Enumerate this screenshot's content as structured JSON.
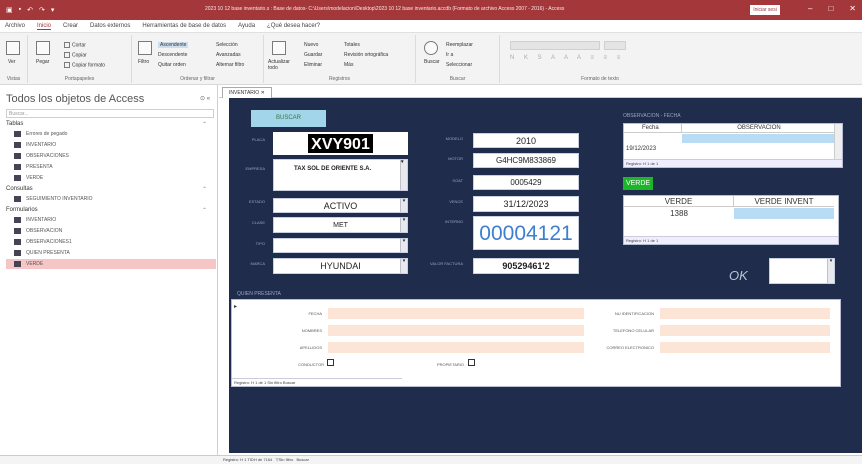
{
  "titlebar": {
    "title": "2023 10 12 base inventario.s : Base de datos- C:\\Users\\modelacion\\Desktop\\2023 10 12 base inventario.accdb (Formato de archivo Access 2007 - 2016) - Access",
    "user": "Iniciar sesi"
  },
  "menu": [
    "Archivo",
    "Inicio",
    "Crear",
    "Datos externos",
    "Herramientas de base de datos",
    "Ayuda",
    "¿Qué desea hacer?"
  ],
  "ribbon": {
    "groups": [
      "Vistas",
      "Portapapeles",
      "Ordenar y filtrar",
      "Registros",
      "Buscar",
      "Formato de texto"
    ],
    "view": "Ver",
    "paste": "Pegar",
    "cut": "Cortar",
    "copy": "Copiar",
    "painter": "Copiar formato",
    "filter": "Filtro",
    "asc": "Ascendente",
    "desc": "Descendente",
    "remove_sort": "Quitar orden",
    "selection": "Selección",
    "advanced": "Avanzadas",
    "toggle": "Alternar filtro",
    "refresh": "Actualizar todo",
    "new": "Nuevo",
    "save": "Guardar",
    "delete": "Eliminar",
    "totals": "Totales",
    "spelling": "Revisión ortográfica",
    "more": "Más",
    "find": "Buscar",
    "replace": "Reemplazar",
    "goto": "Ir a",
    "select": "Seleccionar"
  },
  "nav": {
    "header": "Todos los objetos de Access",
    "search": "Buscar...",
    "tables_title": "Tablas",
    "tables": [
      "Errores de pegado",
      "INVENTARIO",
      "OBSERVACIONES",
      "PRESENTA",
      "VERDE"
    ],
    "queries_title": "Consultas",
    "queries": [
      "SEGUIMIENTO INVENTARIO"
    ],
    "forms_title": "Formularios",
    "forms": [
      "INVENTARIO",
      "OBSERVACION",
      "OBSERVACIONES1",
      "QUIEN PRESENTA",
      "VERDE"
    ]
  },
  "doctab": "INVENTARIO",
  "form": {
    "buscar": "BUSCAR",
    "labels": {
      "placa": "PLACA",
      "empresa": "EMPRESA",
      "estado": "ESTADO",
      "clase": "CLASE",
      "tipo": "TIPO",
      "marca": "MARCA",
      "modelo": "MODELO",
      "motor": "MOTOR",
      "chasis": "SOAT",
      "fecha": "VENCE",
      "serie": "INTERNO",
      "no_factura": "VALOR FACTURA"
    },
    "placa": "XVY901",
    "empresa": "TAX SOL DE ORIENTE S.A.",
    "estado": "ACTIVO",
    "clase": "MET",
    "tipo": "",
    "marca": "HYUNDAI",
    "modelo": "2010",
    "motor": "G4HC9M833869",
    "soat": "0005429",
    "vence": "31/12/2023",
    "interno": "00004121",
    "valor": "90529461'2",
    "obs_title": "OBSERVACION - FECHA",
    "obs_cols": [
      "Fecha",
      "OBSERVACION"
    ],
    "obs_row": "19/12/2023",
    "obs_nav": "Registro: H  1 de 1",
    "verde": "VERDE",
    "verde_cols": [
      "VERDE",
      "VERDE INVENT"
    ],
    "verde_value": "1388",
    "verde_nav": "Registro: H  1 de 1",
    "ok": "OK",
    "quien_title": "QUIEN PRESENTA",
    "quien_left": [
      "FECHA",
      "NOMBRES",
      "APELLIDOS"
    ],
    "conductor": "CONDUCTOR",
    "propietario": "PROPIETARIO",
    "quien_right": [
      "NU IDENTIFICACION",
      "TELEFONO CELULAR",
      "CORREO ELECTRONICO"
    ],
    "quien_nav": "Registro: H  1 de 1   Sin filtro   Buscar"
  },
  "status": {
    "record_nav": "Registro: H  1 TIDH de 7164",
    "filter": "Sin filtro",
    "search": "Buscar"
  }
}
